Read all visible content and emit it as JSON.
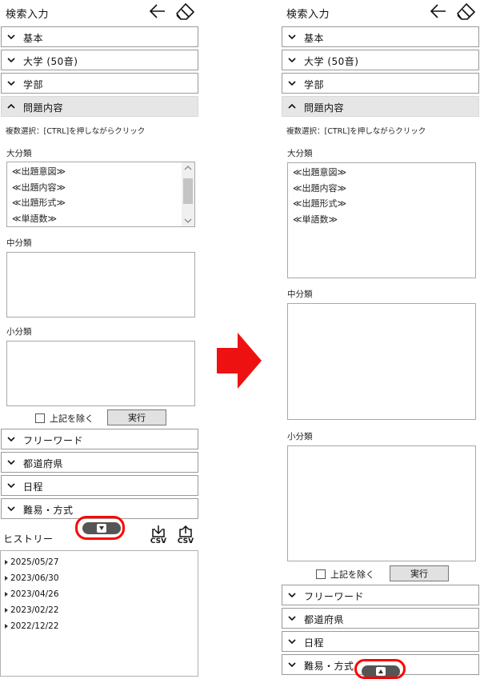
{
  "header": {
    "title": "検索入力",
    "back_icon": "arrow-left-icon",
    "clear_icon": "eraser-icon"
  },
  "sections": {
    "basic": "基本",
    "university": "大学 (50音)",
    "faculty": "学部",
    "question": "問題内容",
    "freeword": "フリーワード",
    "prefecture": "都道府県",
    "schedule": "日程",
    "difficulty": "難易・方式"
  },
  "question_panel": {
    "note": "複数選択：[CTRL]を押しながらクリック",
    "major_label": "大分類",
    "major_options": [
      "≪出題意図≫",
      "≪出題内容≫",
      "≪出題形式≫",
      "≪単語数≫"
    ],
    "middle_label": "中分類",
    "minor_label": "小分類",
    "exclude_label": "上記を除く",
    "run_label": "実行"
  },
  "history": {
    "title": "ヒストリー",
    "import_label": "CSV",
    "export_label": "CSV",
    "items": [
      "2025/05/27",
      "2023/06/30",
      "2023/04/26",
      "2023/02/22",
      "2022/12/22"
    ]
  },
  "colors": {
    "highlight": "#ff0000",
    "accordion_open_bg": "#e6e6e6",
    "toggle_pill": "#555555"
  }
}
